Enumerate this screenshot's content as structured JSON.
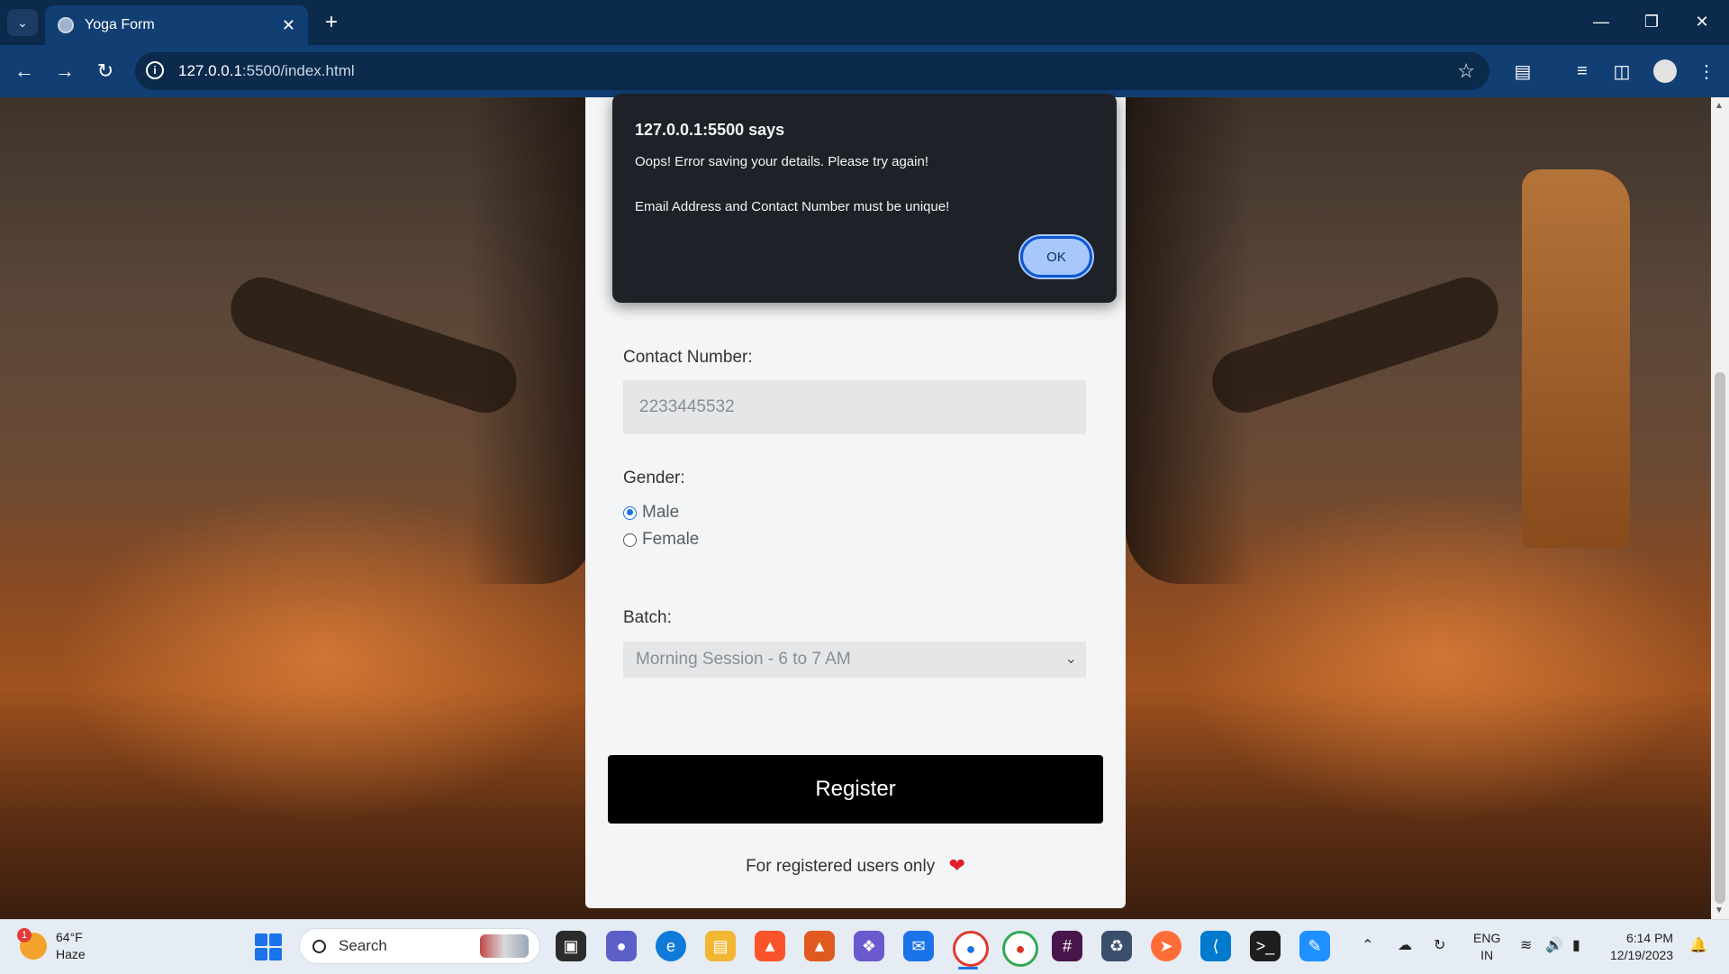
{
  "browser": {
    "tab_title": "Yoga Form",
    "url_host": "127.0.0.1",
    "url_rest": ":5500/index.html"
  },
  "form": {
    "contact_label": "Contact Number:",
    "contact_value": "2233445532",
    "gender_label": "Gender:",
    "gender_options": [
      "Male",
      "Female"
    ],
    "gender_selected": "Male",
    "batch_label": "Batch:",
    "batch_selected": "Morning Session - 6 to 7 AM",
    "register_label": "Register",
    "footnote": "For registered users only"
  },
  "dialog": {
    "title": "127.0.0.1:5500 says",
    "message_line1": "Oops! Error saving your details. Please try again!",
    "message_line2": "Email Address and Contact Number must be unique!",
    "ok_label": "OK"
  },
  "taskbar": {
    "weather_temp": "64°F",
    "weather_desc": "Haze",
    "weather_badge": "1",
    "search_label": "Search",
    "lang_line1": "ENG",
    "lang_line2": "IN",
    "time": "6:14 PM",
    "date": "12/19/2023"
  },
  "icons": {
    "tab_search": "chevron-down-icon",
    "close": "close-icon",
    "new_tab": "plus-icon",
    "bookmark": "star-icon",
    "heart": "heart-pulse-icon"
  },
  "colors": {
    "titlebar": "#0b2a4c",
    "toolbar": "#123f73",
    "dialog_bg": "#1e2127",
    "ok_button": "#a8c7fa",
    "register_button": "#000000",
    "heart": "#e01e2c"
  }
}
